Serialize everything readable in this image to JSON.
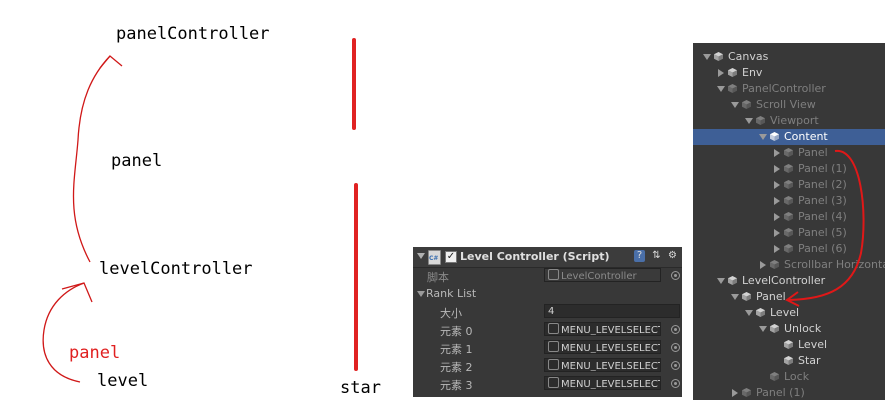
{
  "annotations": {
    "panelController": "panelController",
    "panel": "panel",
    "levelController": "levelController",
    "panel_red": "panel",
    "level": "level",
    "star": "star",
    "arrow_color": "#d01818",
    "bar_color": "#e02222"
  },
  "inspector": {
    "title": "Level Controller (Script)",
    "checkbox_checked": true,
    "script_label": "脚本",
    "script_value": "LevelController",
    "rank_list_label": "Rank List",
    "size_label": "大小",
    "size_value": "4",
    "elements": [
      {
        "label": "元素 0",
        "value": "MENU_LEVELSELECT"
      },
      {
        "label": "元素 1",
        "value": "MENU_LEVELSELECT"
      },
      {
        "label": "元素 2",
        "value": "MENU_LEVELSELECT"
      },
      {
        "label": "元素 3",
        "value": "MENU_LEVELSELECT"
      }
    ]
  },
  "hierarchy": {
    "items": [
      {
        "label": "Canvas",
        "state": "active",
        "expanded": true
      },
      {
        "label": "Env",
        "state": "active",
        "expanded": false
      },
      {
        "label": "PanelController",
        "state": "dim",
        "expanded": true
      },
      {
        "label": "Scroll View",
        "state": "dim",
        "expanded": true
      },
      {
        "label": "Viewport",
        "state": "dim",
        "expanded": true
      },
      {
        "label": "Content",
        "state": "selected",
        "expanded": true
      },
      {
        "label": "Panel",
        "state": "dim",
        "expanded": false
      },
      {
        "label": "Panel (1)",
        "state": "dim",
        "expanded": false
      },
      {
        "label": "Panel (2)",
        "state": "dim",
        "expanded": false
      },
      {
        "label": "Panel (3)",
        "state": "dim",
        "expanded": false
      },
      {
        "label": "Panel (4)",
        "state": "dim",
        "expanded": false
      },
      {
        "label": "Panel (5)",
        "state": "dim",
        "expanded": false
      },
      {
        "label": "Panel (6)",
        "state": "dim",
        "expanded": false
      },
      {
        "label": "Scrollbar Horizontal",
        "state": "dim",
        "expanded": false
      },
      {
        "label": "LevelController",
        "state": "active",
        "expanded": true
      },
      {
        "label": "Panel",
        "state": "active",
        "expanded": true
      },
      {
        "label": "Level",
        "state": "active",
        "expanded": true
      },
      {
        "label": "Unlock",
        "state": "active",
        "expanded": true
      },
      {
        "label": "Level",
        "state": "active",
        "expanded": null
      },
      {
        "label": "Star",
        "state": "active",
        "expanded": null
      },
      {
        "label": "Lock",
        "state": "dim",
        "expanded": null
      },
      {
        "label": "Panel (1)",
        "state": "dim",
        "expanded": false
      }
    ]
  }
}
